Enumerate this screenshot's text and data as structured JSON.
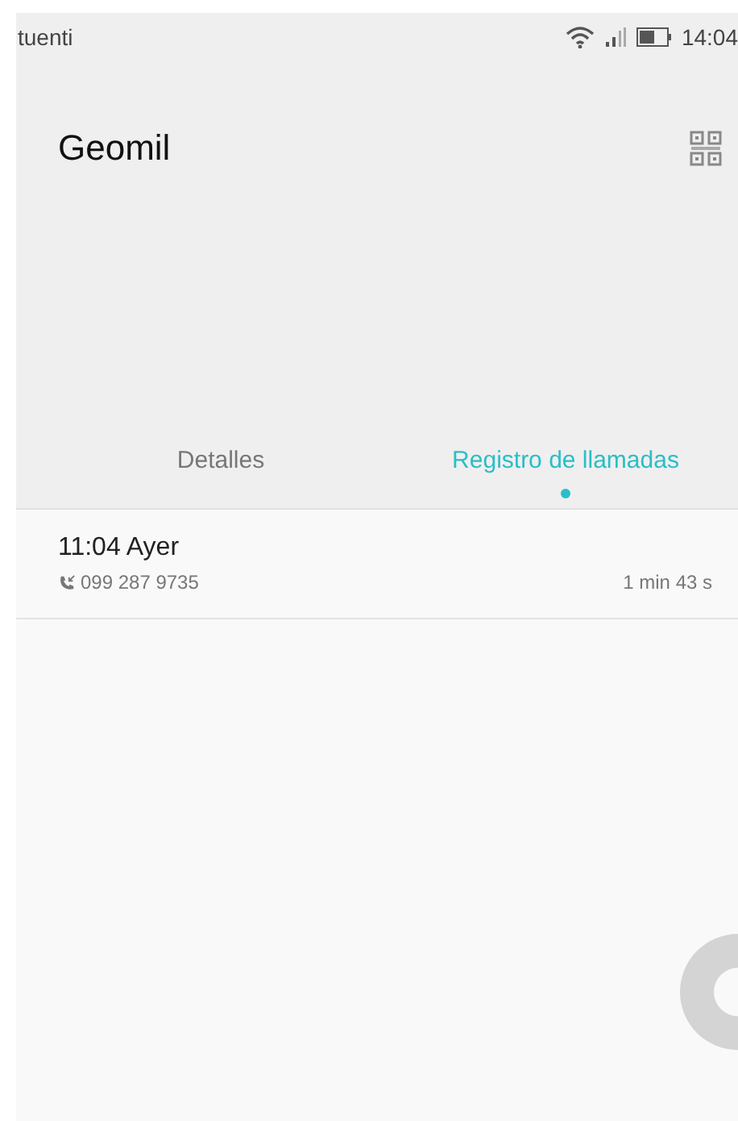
{
  "status_bar": {
    "carrier": "tuenti",
    "time": "14:04"
  },
  "contact": {
    "name": "Geomil"
  },
  "tabs": [
    {
      "label": "Detalles",
      "selected": false
    },
    {
      "label": "Registro de llamadas",
      "selected": true
    }
  ],
  "calls": [
    {
      "kind": "incoming",
      "when": "11:04 Ayer",
      "number": "099 287 9735",
      "duration": "1 min 43 s"
    }
  ]
}
